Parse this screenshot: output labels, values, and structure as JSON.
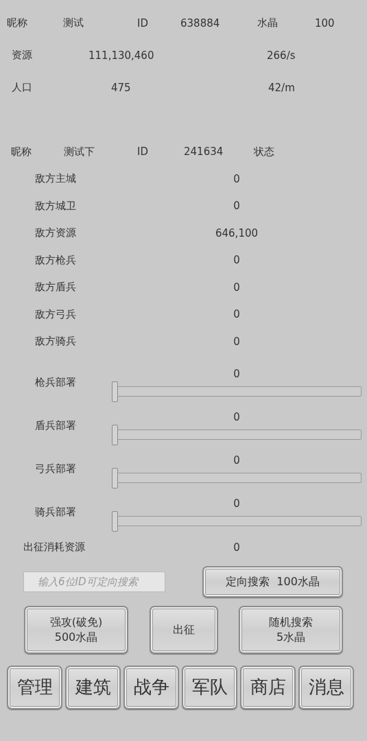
{
  "player": {
    "nickname_label": "昵称",
    "nickname": "测试",
    "id_label": "ID",
    "id": "638884",
    "crystal_label": "水晶",
    "crystal": "100",
    "resource_label": "资源",
    "resources": "111,130,460",
    "resource_rate": "266/s",
    "population_label": "人口",
    "population": "475",
    "population_rate": "42/m"
  },
  "target": {
    "nickname_label": "昵称",
    "nickname": "测试下",
    "id_label": "ID",
    "id": "241634",
    "status_label": "状态"
  },
  "enemy_stats": [
    {
      "label": "敌方主城",
      "value": "0"
    },
    {
      "label": "敌方城卫",
      "value": "0"
    },
    {
      "label": "敌方资源",
      "value": "646,100"
    },
    {
      "label": "敌方枪兵",
      "value": "0"
    },
    {
      "label": "敌方盾兵",
      "value": "0"
    },
    {
      "label": "敌方弓兵",
      "value": "0"
    },
    {
      "label": "敌方骑兵",
      "value": "0"
    }
  ],
  "deployments": [
    {
      "label": "枪兵部署",
      "value": "0",
      "level": 0
    },
    {
      "label": "盾兵部署",
      "value": "0",
      "level": 0
    },
    {
      "label": "弓兵部署",
      "value": "0",
      "level": 0
    },
    {
      "label": "骑兵部署",
      "value": "0",
      "level": 0
    }
  ],
  "cost": {
    "label": "出征消耗资源",
    "value": "0"
  },
  "search": {
    "placeholder": "输入6位ID可定向搜索",
    "button": "定向搜索  100水晶"
  },
  "actions": [
    {
      "lines": [
        "强攻(破免)",
        "500水晶"
      ]
    },
    {
      "lines": [
        "出征"
      ]
    },
    {
      "lines": [
        "随机搜索",
        "5水晶"
      ]
    }
  ],
  "tabs": [
    "管理",
    "建筑",
    "战争",
    "军队",
    "商店",
    "消息"
  ]
}
